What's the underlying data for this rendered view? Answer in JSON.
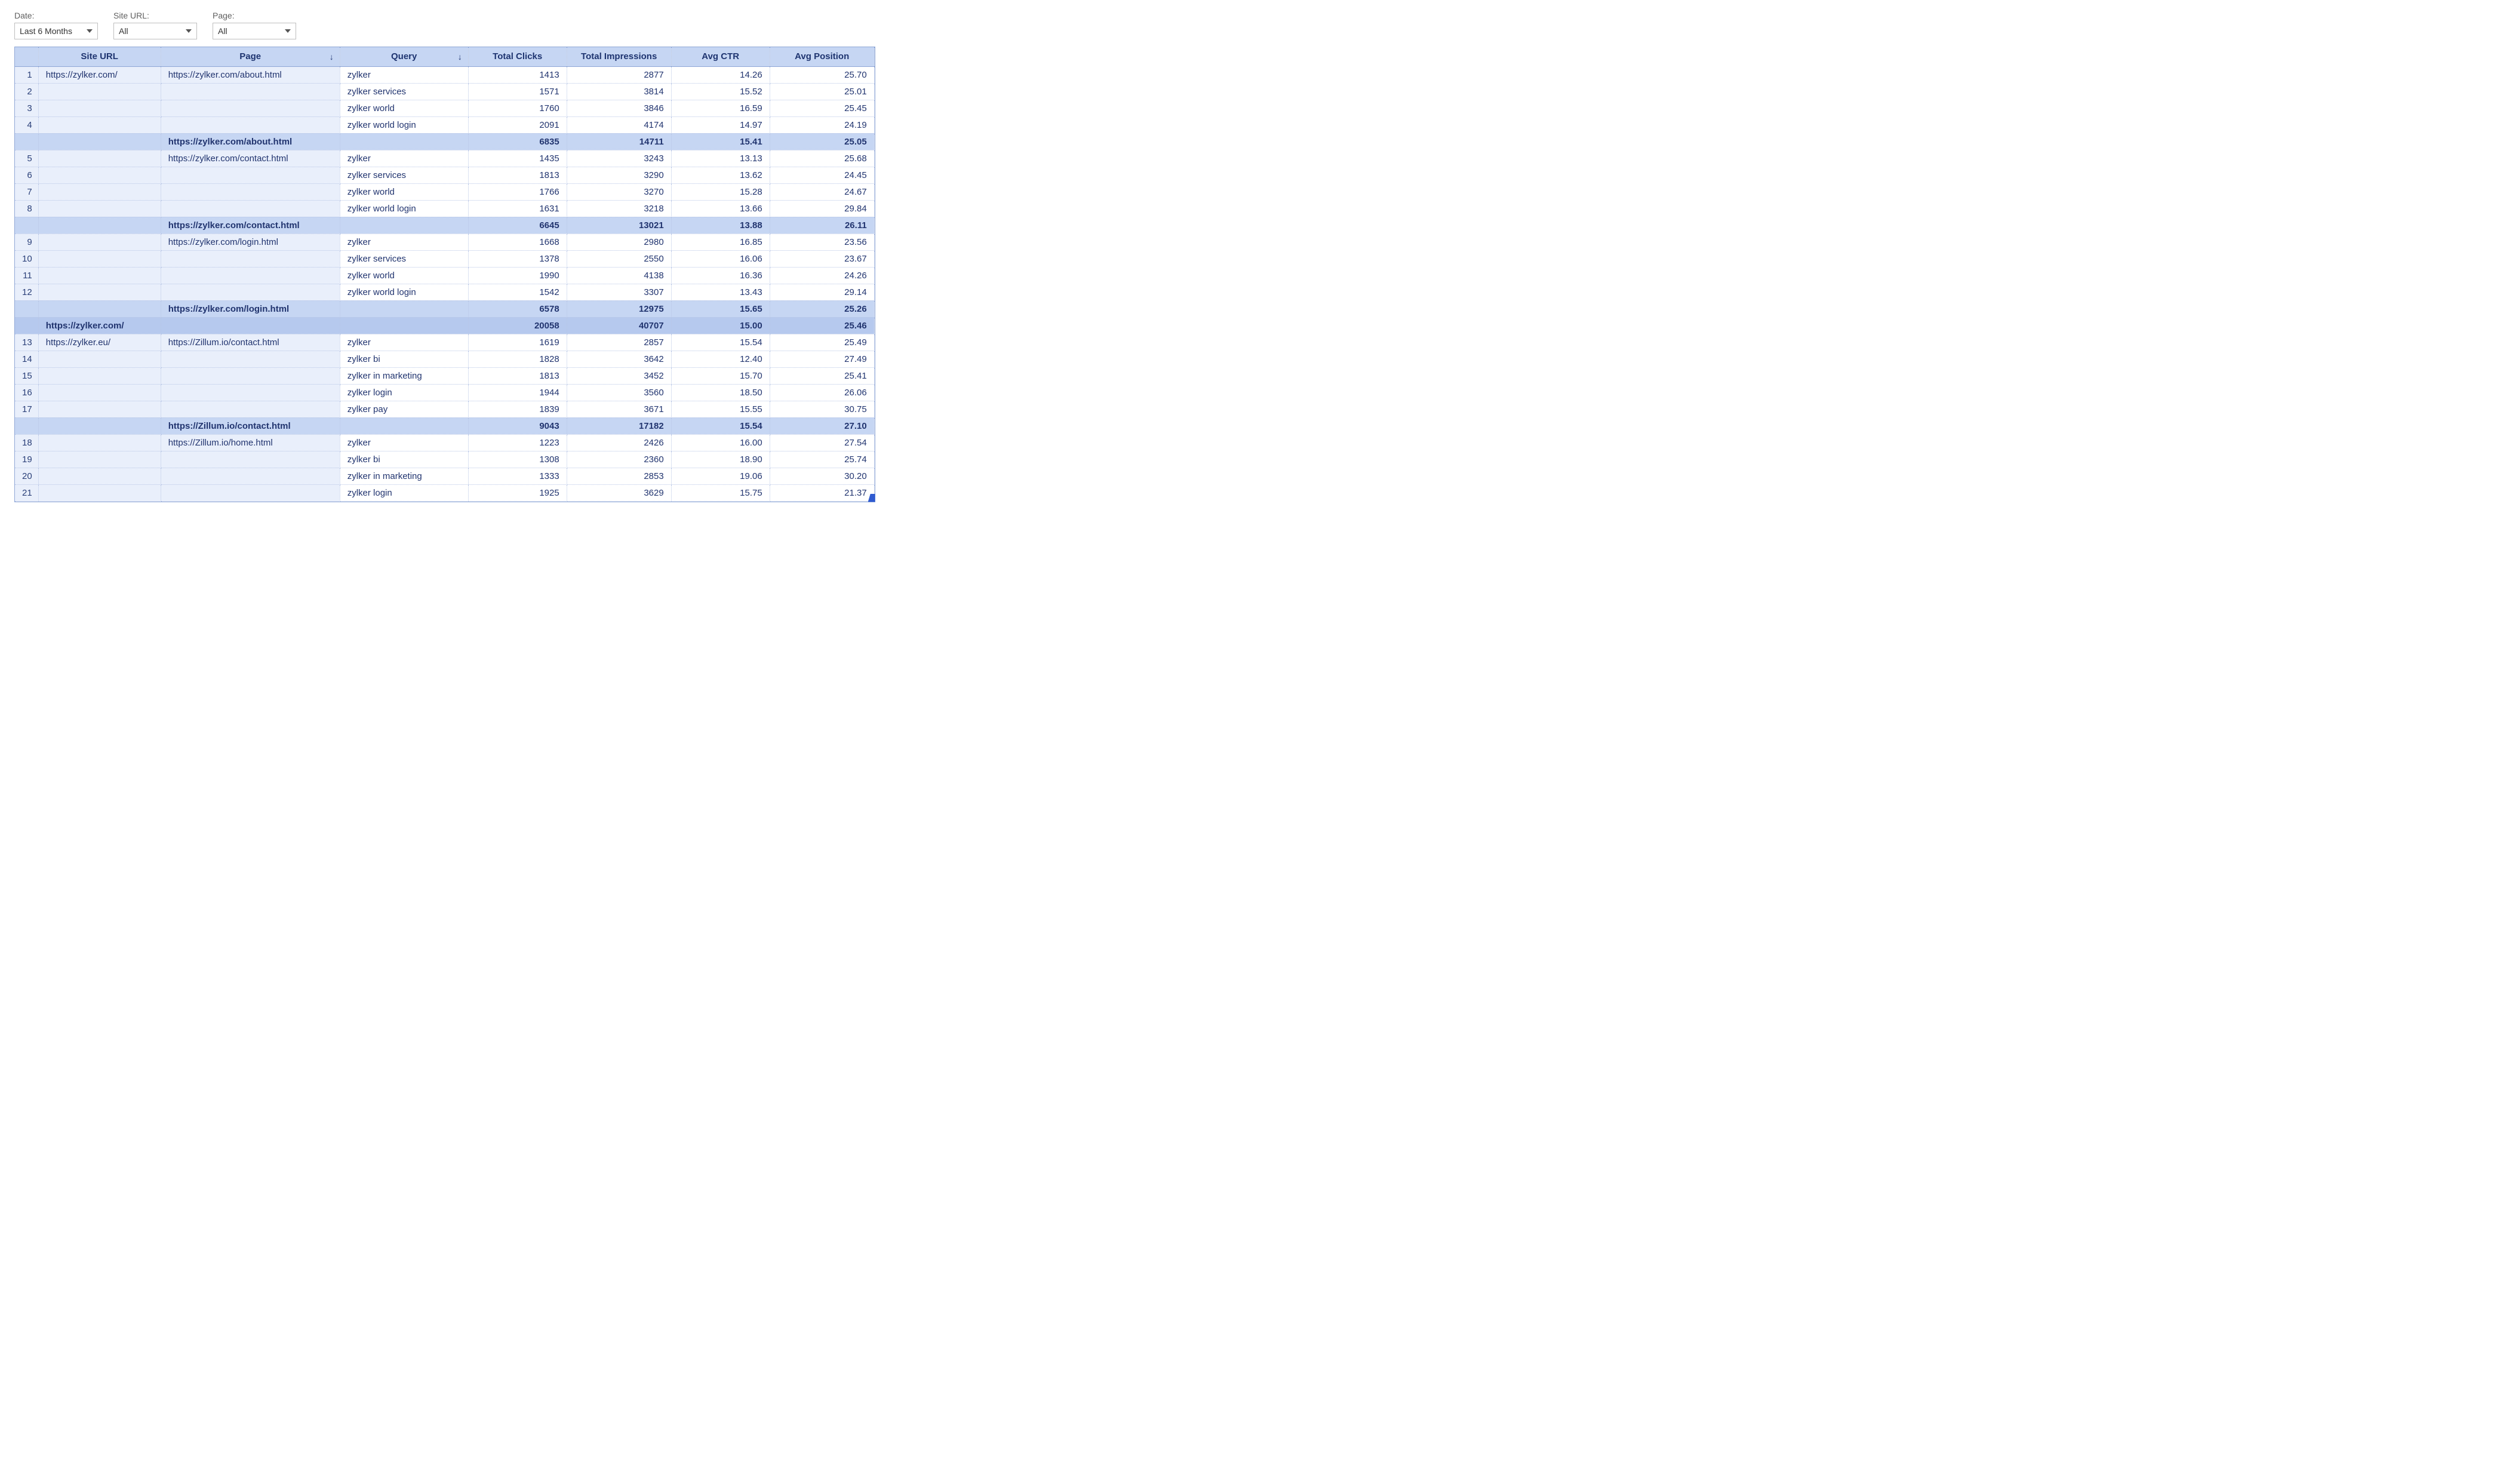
{
  "filters": {
    "date": {
      "label": "Date:",
      "value": "Last 6 Months"
    },
    "site": {
      "label": "Site URL:",
      "value": "All"
    },
    "page": {
      "label": "Page:",
      "value": "All"
    }
  },
  "columns": [
    {
      "key": "site_url",
      "label": "Site URL"
    },
    {
      "key": "page",
      "label": "Page",
      "sort": "desc"
    },
    {
      "key": "query",
      "label": "Query",
      "sort": "desc"
    },
    {
      "key": "clicks",
      "label": "Total Clicks"
    },
    {
      "key": "impr",
      "label": "Total Impressions"
    },
    {
      "key": "ctr",
      "label": "Avg CTR"
    },
    {
      "key": "pos",
      "label": "Avg Position"
    }
  ],
  "rows": [
    {
      "n": 1,
      "site": "https://zylker.com/",
      "page": "https://zylker.com/about.html",
      "query": "zylker",
      "clicks": "1413",
      "impr": "2877",
      "ctr": "14.26",
      "pos": "25.70"
    },
    {
      "n": 2,
      "site": "",
      "page": "",
      "query": "zylker services",
      "clicks": "1571",
      "impr": "3814",
      "ctr": "15.52",
      "pos": "25.01"
    },
    {
      "n": 3,
      "site": "",
      "page": "",
      "query": "zylker world",
      "clicks": "1760",
      "impr": "3846",
      "ctr": "16.59",
      "pos": "25.45"
    },
    {
      "n": 4,
      "site": "",
      "page": "",
      "query": "zylker world login",
      "clicks": "2091",
      "impr": "4174",
      "ctr": "14.97",
      "pos": "24.19"
    },
    {
      "type": "subtotal",
      "site": "",
      "page": "https://zylker.com/about.html",
      "query": "",
      "clicks": "6835",
      "impr": "14711",
      "ctr": "15.41",
      "pos": "25.05"
    },
    {
      "n": 5,
      "site": "",
      "page": "https://zylker.com/contact.html",
      "query": "zylker",
      "clicks": "1435",
      "impr": "3243",
      "ctr": "13.13",
      "pos": "25.68"
    },
    {
      "n": 6,
      "site": "",
      "page": "",
      "query": "zylker services",
      "clicks": "1813",
      "impr": "3290",
      "ctr": "13.62",
      "pos": "24.45"
    },
    {
      "n": 7,
      "site": "",
      "page": "",
      "query": "zylker world",
      "clicks": "1766",
      "impr": "3270",
      "ctr": "15.28",
      "pos": "24.67"
    },
    {
      "n": 8,
      "site": "",
      "page": "",
      "query": "zylker world login",
      "clicks": "1631",
      "impr": "3218",
      "ctr": "13.66",
      "pos": "29.84"
    },
    {
      "type": "subtotal",
      "site": "",
      "page": "https://zylker.com/contact.html",
      "query": "",
      "clicks": "6645",
      "impr": "13021",
      "ctr": "13.88",
      "pos": "26.11"
    },
    {
      "n": 9,
      "site": "",
      "page": "https://zylker.com/login.html",
      "query": "zylker",
      "clicks": "1668",
      "impr": "2980",
      "ctr": "16.85",
      "pos": "23.56"
    },
    {
      "n": 10,
      "site": "",
      "page": "",
      "query": "zylker services",
      "clicks": "1378",
      "impr": "2550",
      "ctr": "16.06",
      "pos": "23.67"
    },
    {
      "n": 11,
      "site": "",
      "page": "",
      "query": "zylker world",
      "clicks": "1990",
      "impr": "4138",
      "ctr": "16.36",
      "pos": "24.26"
    },
    {
      "n": 12,
      "site": "",
      "page": "",
      "query": "zylker world login",
      "clicks": "1542",
      "impr": "3307",
      "ctr": "13.43",
      "pos": "29.14"
    },
    {
      "type": "subtotal",
      "site": "",
      "page": "https://zylker.com/login.html",
      "query": "",
      "clicks": "6578",
      "impr": "12975",
      "ctr": "15.65",
      "pos": "25.26"
    },
    {
      "type": "sitetotal",
      "site": "https://zylker.com/",
      "page": "",
      "query": "",
      "clicks": "20058",
      "impr": "40707",
      "ctr": "15.00",
      "pos": "25.46"
    },
    {
      "n": 13,
      "site": "https://zylker.eu/",
      "page": "https://Zillum.io/contact.html",
      "query": "zylker",
      "clicks": "1619",
      "impr": "2857",
      "ctr": "15.54",
      "pos": "25.49"
    },
    {
      "n": 14,
      "site": "",
      "page": "",
      "query": "zylker bi",
      "clicks": "1828",
      "impr": "3642",
      "ctr": "12.40",
      "pos": "27.49"
    },
    {
      "n": 15,
      "site": "",
      "page": "",
      "query": "zylker in marketing",
      "clicks": "1813",
      "impr": "3452",
      "ctr": "15.70",
      "pos": "25.41"
    },
    {
      "n": 16,
      "site": "",
      "page": "",
      "query": "zylker login",
      "clicks": "1944",
      "impr": "3560",
      "ctr": "18.50",
      "pos": "26.06"
    },
    {
      "n": 17,
      "site": "",
      "page": "",
      "query": "zylker pay",
      "clicks": "1839",
      "impr": "3671",
      "ctr": "15.55",
      "pos": "30.75"
    },
    {
      "type": "subtotal",
      "site": "",
      "page": "https://Zillum.io/contact.html",
      "query": "",
      "clicks": "9043",
      "impr": "17182",
      "ctr": "15.54",
      "pos": "27.10"
    },
    {
      "n": 18,
      "site": "",
      "page": "https://Zillum.io/home.html",
      "query": "zylker",
      "clicks": "1223",
      "impr": "2426",
      "ctr": "16.00",
      "pos": "27.54"
    },
    {
      "n": 19,
      "site": "",
      "page": "",
      "query": "zylker bi",
      "clicks": "1308",
      "impr": "2360",
      "ctr": "18.90",
      "pos": "25.74"
    },
    {
      "n": 20,
      "site": "",
      "page": "",
      "query": "zylker in marketing",
      "clicks": "1333",
      "impr": "2853",
      "ctr": "19.06",
      "pos": "30.20"
    },
    {
      "n": 21,
      "site": "",
      "page": "",
      "query": "zylker login",
      "clicks": "1925",
      "impr": "3629",
      "ctr": "15.75",
      "pos": "21.37"
    }
  ]
}
